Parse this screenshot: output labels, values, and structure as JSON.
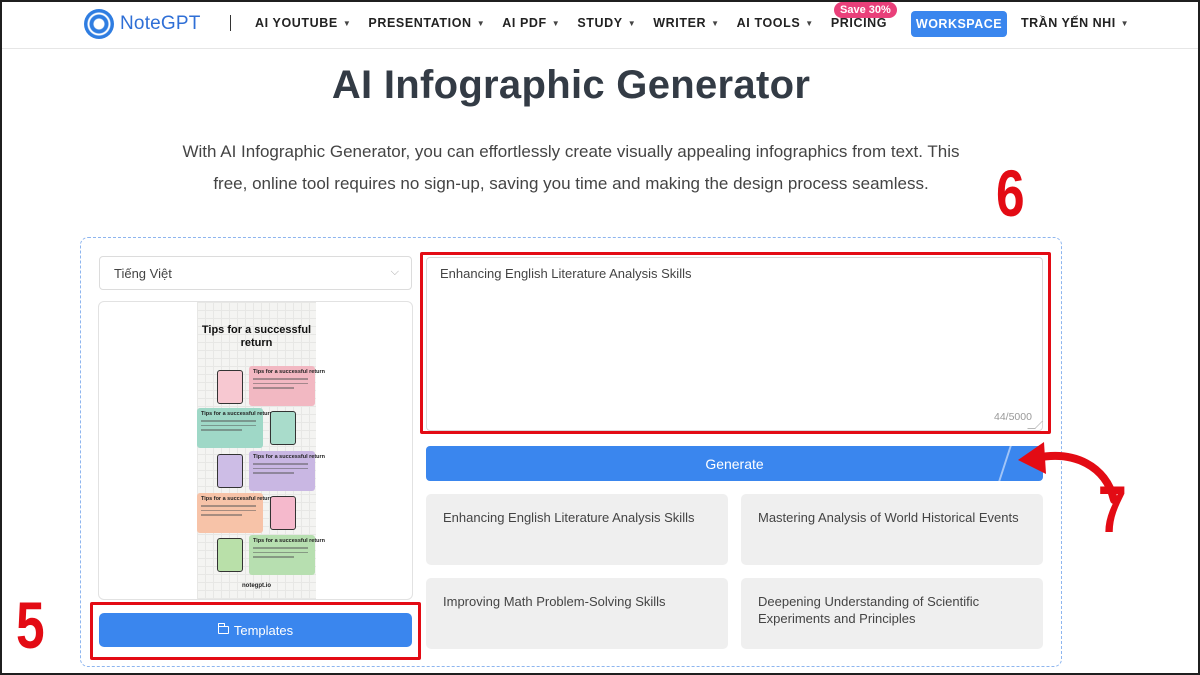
{
  "nav": {
    "logo_text": "NoteGPT",
    "items": [
      {
        "label": "AI YOUTUBE",
        "has_caret": true
      },
      {
        "label": "PRESENTATION",
        "has_caret": true
      },
      {
        "label": "AI PDF",
        "has_caret": true
      },
      {
        "label": "STUDY",
        "has_caret": true
      },
      {
        "label": "WRITER",
        "has_caret": true
      },
      {
        "label": "AI TOOLS",
        "has_caret": true
      },
      {
        "label": "PRICING",
        "has_caret": false
      }
    ],
    "pricing_badge": "Save 30%",
    "workspace_label": "WORKSPACE",
    "user_name": "TRẦN YẾN NHI"
  },
  "hero": {
    "title": "AI Infographic Generator",
    "description": "With AI Infographic Generator, you can effortlessly create visually appealing infographics from text. This free, online tool requires no sign-up, saving you time and making the design process seamless."
  },
  "tool": {
    "language_value": "Tiếng Việt",
    "preview": {
      "title": "Tips for a successful return",
      "card_heading": "Tips for a successful return",
      "footer": "notegpt.io",
      "colors": [
        "#f2b8c2",
        "#9fd8c7",
        "#c9b7e3",
        "#f7c3a8",
        "#b7dfb0"
      ]
    },
    "templates_label": "Templates",
    "prompt_value": "Enhancing English Literature Analysis Skills",
    "char_count": "44/5000",
    "generate_label": "Generate",
    "suggestions": [
      "Enhancing English Literature Analysis Skills",
      "Mastering Analysis of World Historical Events",
      "Improving Math Problem-Solving Skills",
      "Deepening Understanding of Scientific Experiments and Principles"
    ]
  },
  "annotations": {
    "label_5": "5",
    "label_6": "6",
    "label_7": "7",
    "color": "#e30b14"
  }
}
